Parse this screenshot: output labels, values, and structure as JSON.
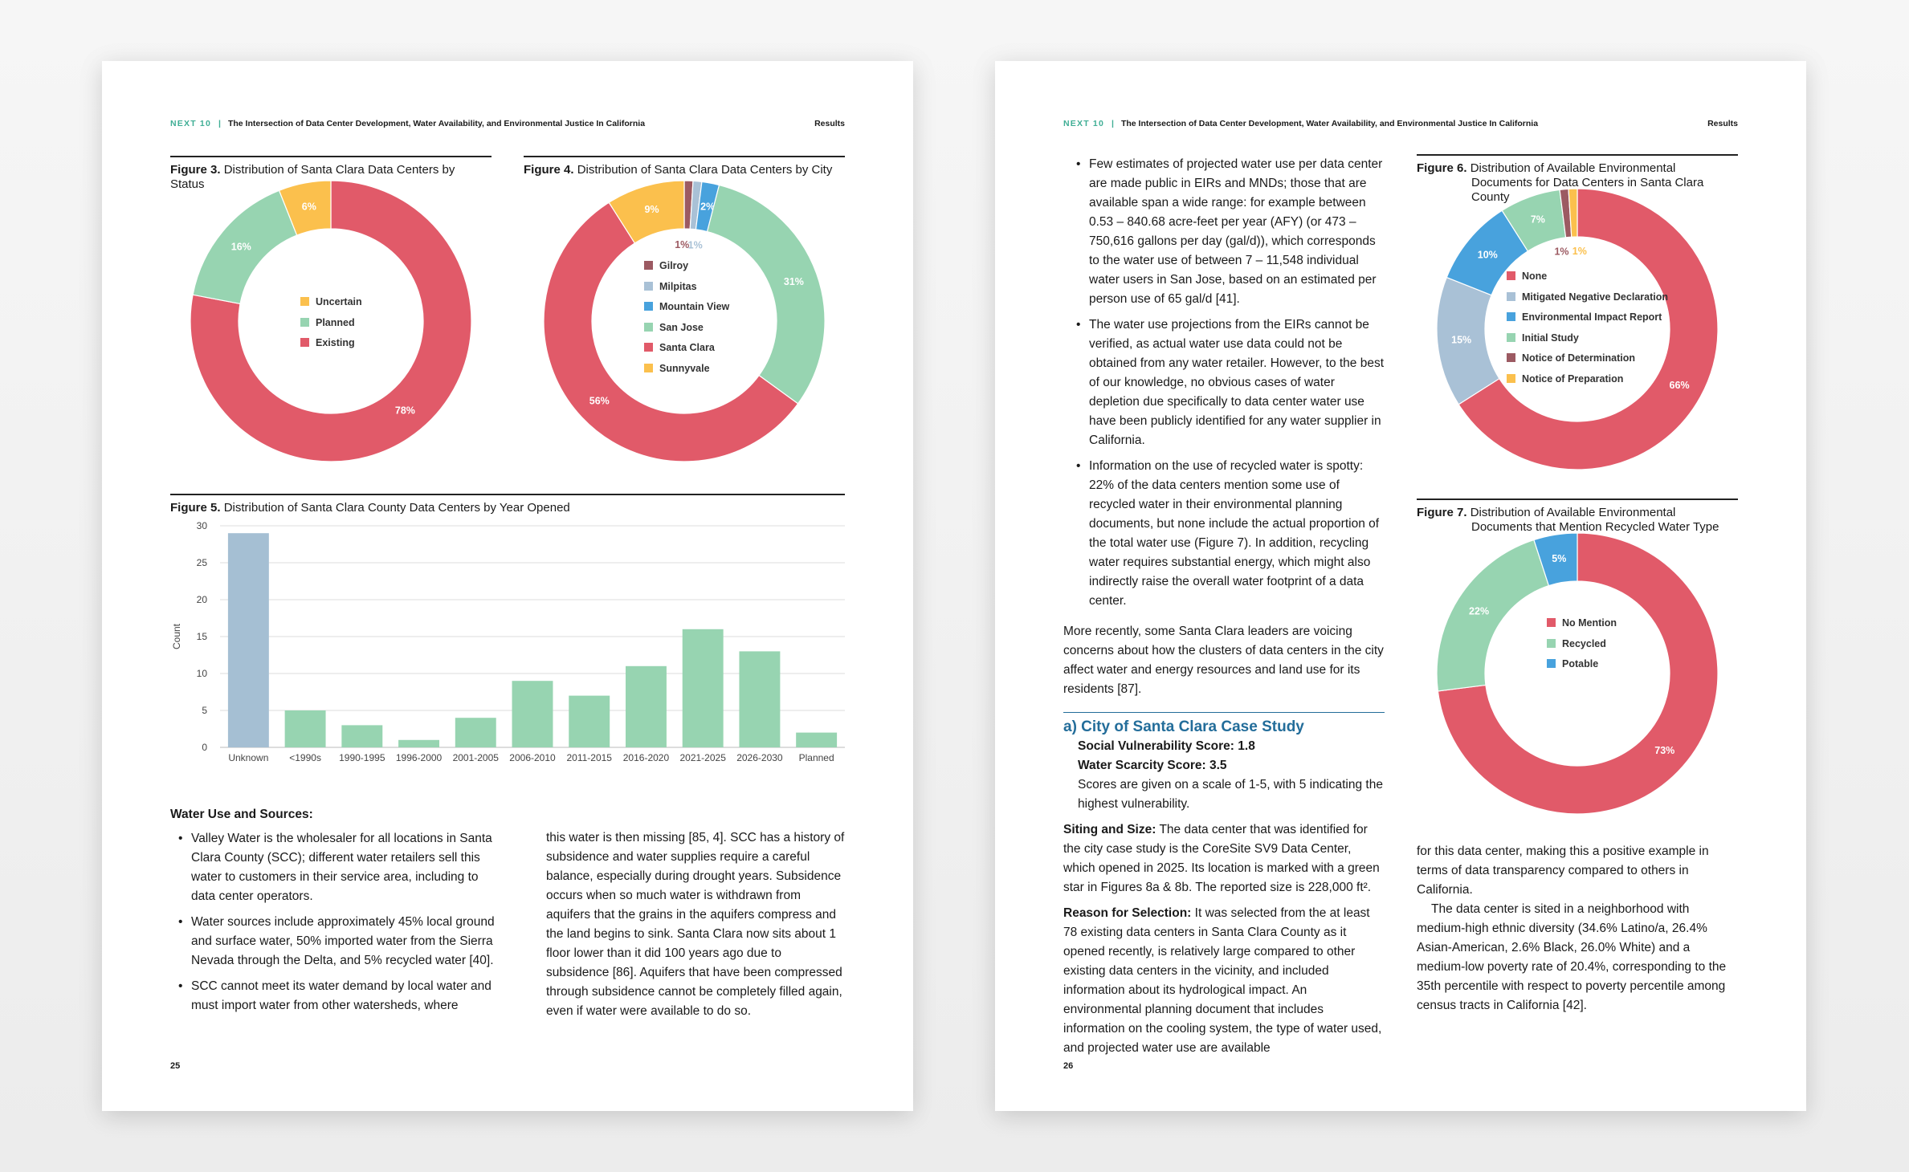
{
  "header": {
    "brand": "NEXT 10",
    "separator": "|",
    "title": "The Intersection of Data Center Development, Water Availability, and Environmental Justice In California",
    "section": "Results"
  },
  "left_page": {
    "page_number": "25",
    "fig3": {
      "label": "Figure 3.",
      "title": "Distribution of Santa Clara Data Centers by Status"
    },
    "fig4": {
      "label": "Figure 4.",
      "title": "Distribution of Santa Clara Data Centers by City"
    },
    "fig5": {
      "label": "Figure 5.",
      "title": "Distribution of Santa Clara County Data Centers by Year Opened"
    },
    "water_heading": "Water Use and Sources:",
    "bullets_col1": [
      "Valley Water is the wholesaler for all locations in Santa Clara County (SCC); different water retailers sell this water to customers in their service area, including to data center operators.",
      "Water sources include approximately 45% local ground and surface water, 50% imported water from the Sierra Nevada through the Delta, and 5% recycled water [40].",
      "SCC cannot meet its water demand by local water and must import water from other watersheds, where"
    ],
    "col2_text": "this water is then missing [85, 4]. SCC has a history of subsidence and water supplies require a careful balance, especially during drought years. Subsidence occurs when so much water is withdrawn from aquifers that the grains in the aquifers compress and the land begins to sink. Santa Clara now sits about 1 floor lower than it did 100 years ago due to subsidence [86]. Aquifers that have been compressed through subsidence cannot be completely filled again, even if water were available to do so."
  },
  "right_page": {
    "page_number": "26",
    "bullets": [
      "Few estimates of projected water use per data center are made public in EIRs and MNDs; those that are available span a wide range: for example between 0.53 – 840.68 acre-feet per year (AFY) (or 473 – 750,616 gallons per day (gal/d)), which corresponds to the water use of between 7 – 11,548 individual water users in San Jose, based on an estimated per person use of 65 gal/d [41].",
      "The water use projections from the EIRs cannot be verified, as actual water use data could not be obtained from any water retailer. However, to the best of our knowledge, no obvious cases of water depletion due specifically to data center water use have been publicly identified for any water supplier in California.",
      "Information on the use of recycled water is spotty: 22% of the data centers mention some use of recycled water in their environmental planning documents, but none include the actual proportion of the total water use (Figure 7). In addition, recycling water requires substantial energy, which might also indirectly raise the overall water footprint of a data center."
    ],
    "para_recent": "More recently, some Santa Clara leaders are voicing concerns about how the clusters of data centers in the city affect water and energy resources and land use for its residents [87].",
    "case_title": "a) City of Santa Clara Case Study",
    "svs_label": "Social Vulnerability Score: 1.8",
    "wss_label": "Water Scarcity Score: 3.5",
    "scale_note": "Scores are given on a scale of 1-5, with 5 indicating the highest vulnerability.",
    "siting_label": "Siting and Size:",
    "siting_text": "The data center that was identified for the city case study is the CoreSite SV9 Data Center, which opened in 2025. Its location is marked with a green star in Figures 8a & 8b. The reported size is 228,000 ft².",
    "reason_label": "Reason for Selection:",
    "reason_text": "It was selected from the at least 78 existing data centers in Santa Clara County as it opened recently, is relatively large compared to other existing data centers in the vicinity, and included information about its hydrological impact. An environmental planning document that includes information on the cooling system, the type of water used, and projected water use are available",
    "col2_para1": "for this data center, making this a positive example in terms of data transparency compared to others in California.",
    "col2_para2": "The data center is sited in a neighborhood with medium-high ethnic diversity (34.6% Latino/a, 26.4% Asian-American, 2.6% Black, 26.0% White) and a medium-low poverty rate of 20.4%, corresponding to the 35th percentile with respect to poverty percentile among census tracts in California [42].",
    "fig6": {
      "label": "Figure 6.",
      "title": "Distribution of Available Environmental Documents for Data Centers in Santa Clara County"
    },
    "fig7": {
      "label": "Figure 7.",
      "title": "Distribution of Available Environmental Documents that Mention Recycled Water Type"
    }
  },
  "chart_data": [
    {
      "type": "pie",
      "title": "Figure 3. Distribution of Santa Clara Data Centers by Status",
      "categories": [
        "Uncertain",
        "Planned",
        "Existing"
      ],
      "values": [
        6,
        16,
        78
      ],
      "labels": [
        "6%",
        "16%",
        "78%"
      ],
      "colors": [
        "#fbc04d",
        "#97d4b1",
        "#e15a69"
      ],
      "legend_order": [
        0,
        1,
        2
      ],
      "order": [
        2,
        1,
        0
      ],
      "legend": "center"
    },
    {
      "type": "pie",
      "title": "Figure 4. Distribution of Santa Clara Data Centers by City",
      "categories": [
        "Gilroy",
        "Milpitas",
        "Mountain View",
        "San Jose",
        "Santa Clara",
        "Sunnyvale"
      ],
      "values": [
        1,
        1,
        2,
        31,
        56,
        9
      ],
      "labels": [
        "1%",
        "1%",
        "2%",
        "31%",
        "56%",
        "9%"
      ],
      "colors": [
        "#9c5a62",
        "#a9c1d6",
        "#48a2dd",
        "#97d4b1",
        "#e15a69",
        "#fbc04d"
      ],
      "legend_order": [
        0,
        1,
        2,
        3,
        4,
        5
      ],
      "order": [
        0,
        1,
        2,
        3,
        4,
        5
      ],
      "legend": "center"
    },
    {
      "type": "bar",
      "title": "Figure 5. Distribution of Santa Clara County Data Centers by Year Opened",
      "categories": [
        "Unknown",
        "<1990s",
        "1990-1995",
        "1996-2000",
        "2001-2005",
        "2006-2010",
        "2011-2015",
        "2016-2020",
        "2021-2025",
        "2026-2030",
        "Planned"
      ],
      "values": [
        29,
        5,
        3,
        1,
        4,
        9,
        7,
        11,
        16,
        13,
        2
      ],
      "colors": [
        "#a5bfd3",
        "#97d4b1"
      ],
      "xlabel": "",
      "ylabel": "Count",
      "ylim": [
        0,
        30
      ],
      "yticks": [
        0,
        5,
        10,
        15,
        20,
        25,
        30
      ],
      "grid": true
    },
    {
      "type": "pie",
      "title": "Figure 6. Distribution of Available Environmental Documents for Data Centers in Santa Clara County",
      "categories": [
        "None",
        "Mitigated Negative Declaration",
        "Environmental Impact Report",
        "Initial Study",
        "Notice of Determination",
        "Notice of Preparation"
      ],
      "values": [
        66,
        15,
        10,
        7,
        1,
        1
      ],
      "labels": [
        "66%",
        "15%",
        "10%",
        "7%",
        "1%",
        "1%"
      ],
      "colors": [
        "#e15a69",
        "#a9c1d6",
        "#48a2dd",
        "#97d4b1",
        "#9c5a62",
        "#fbc04d"
      ],
      "legend_order": [
        0,
        1,
        2,
        3,
        4,
        5
      ],
      "order": [
        0,
        1,
        2,
        3,
        4,
        5
      ],
      "legend": "center"
    },
    {
      "type": "pie",
      "title": "Figure 7. Distribution of Available Environmental Documents that Mention Recycled Water Type",
      "categories": [
        "No Mention",
        "Recycled",
        "Potable"
      ],
      "values": [
        73,
        22,
        5
      ],
      "labels": [
        "73%",
        "22%",
        "5%"
      ],
      "colors": [
        "#e15a69",
        "#97d4b1",
        "#48a2dd"
      ],
      "legend_order": [
        0,
        1,
        2
      ],
      "order": [
        0,
        1,
        2
      ],
      "legend": "center"
    }
  ]
}
